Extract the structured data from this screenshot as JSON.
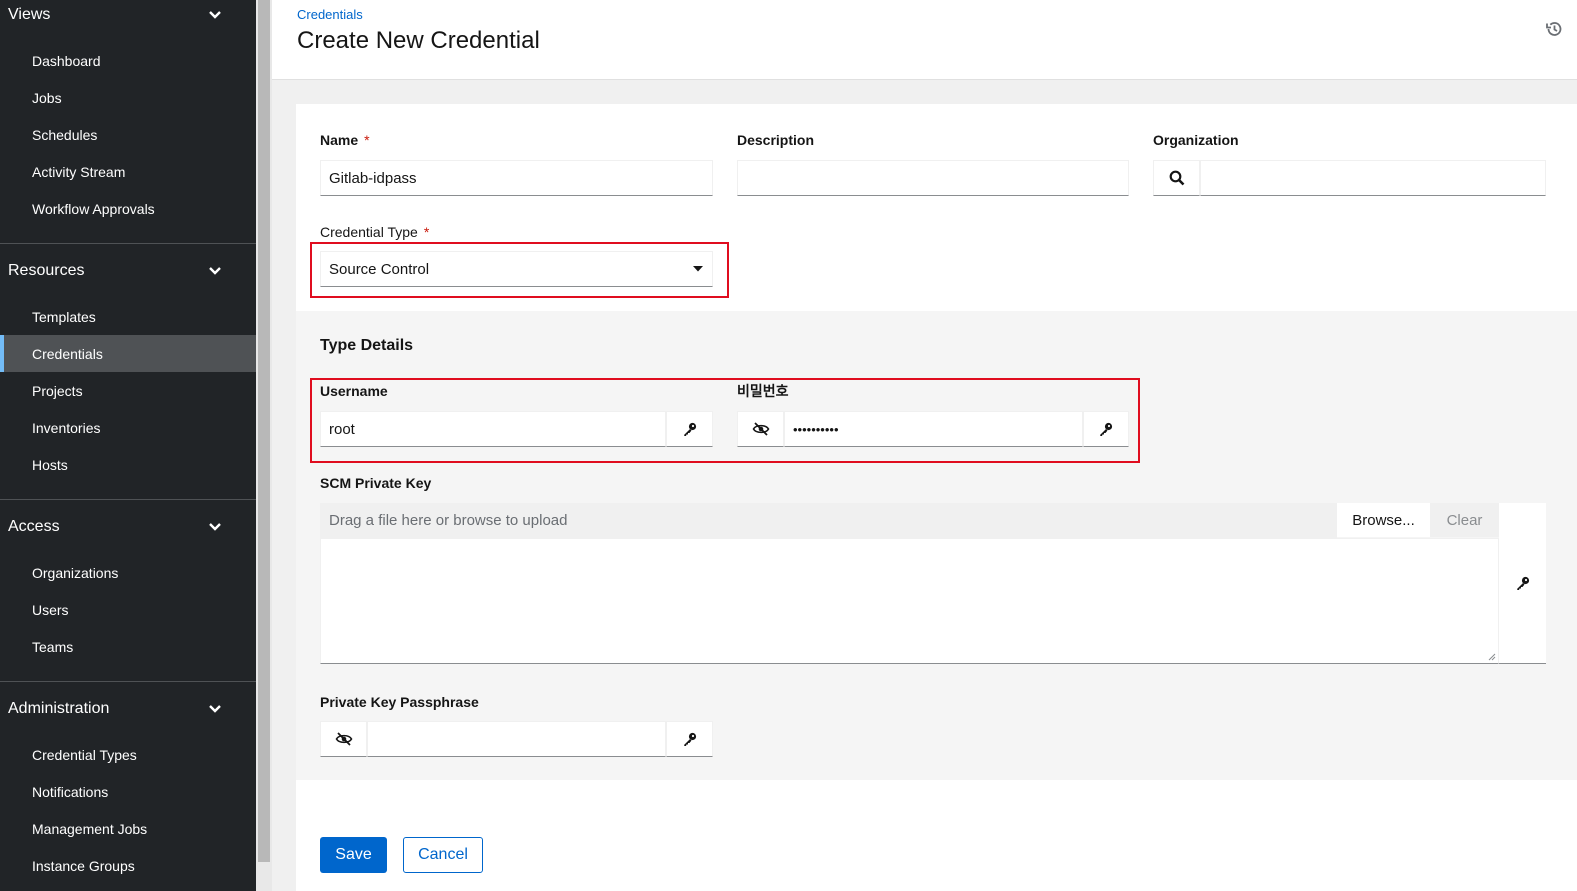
{
  "sidebar": {
    "groups": [
      {
        "title": "Views",
        "items": [
          "Dashboard",
          "Jobs",
          "Schedules",
          "Activity Stream",
          "Workflow Approvals"
        ]
      },
      {
        "title": "Resources",
        "items": [
          "Templates",
          "Credentials",
          "Projects",
          "Inventories",
          "Hosts"
        ]
      },
      {
        "title": "Access",
        "items": [
          "Organizations",
          "Users",
          "Teams"
        ]
      },
      {
        "title": "Administration",
        "items": [
          "Credential Types",
          "Notifications",
          "Management Jobs",
          "Instance Groups"
        ]
      }
    ],
    "active_item": "Credentials"
  },
  "header": {
    "breadcrumb": "Credentials",
    "title": "Create New Credential"
  },
  "form": {
    "name_label": "Name",
    "name_value": "Gitlab-idpass",
    "description_label": "Description",
    "description_value": "",
    "organization_label": "Organization",
    "organization_value": "",
    "required_mark": "*",
    "credential_type_label": "Credential Type",
    "credential_type_value": "Source Control"
  },
  "type_details": {
    "title": "Type Details",
    "username_label": "Username",
    "username_value": "root",
    "password_label": "비밀번호",
    "password_mask": "••••••••••",
    "scm_key_label": "SCM Private Key",
    "scm_key_placeholder": "Drag a file here or browse to upload",
    "browse_label": "Browse...",
    "clear_label": "Clear",
    "passphrase_label": "Private Key Passphrase",
    "passphrase_value": ""
  },
  "actions": {
    "save_label": "Save",
    "cancel_label": "Cancel"
  },
  "colors": {
    "sidebar_bg": "#212427",
    "primary": "#0066cc",
    "required": "#c9190b",
    "highlight": "#e00d1f"
  }
}
